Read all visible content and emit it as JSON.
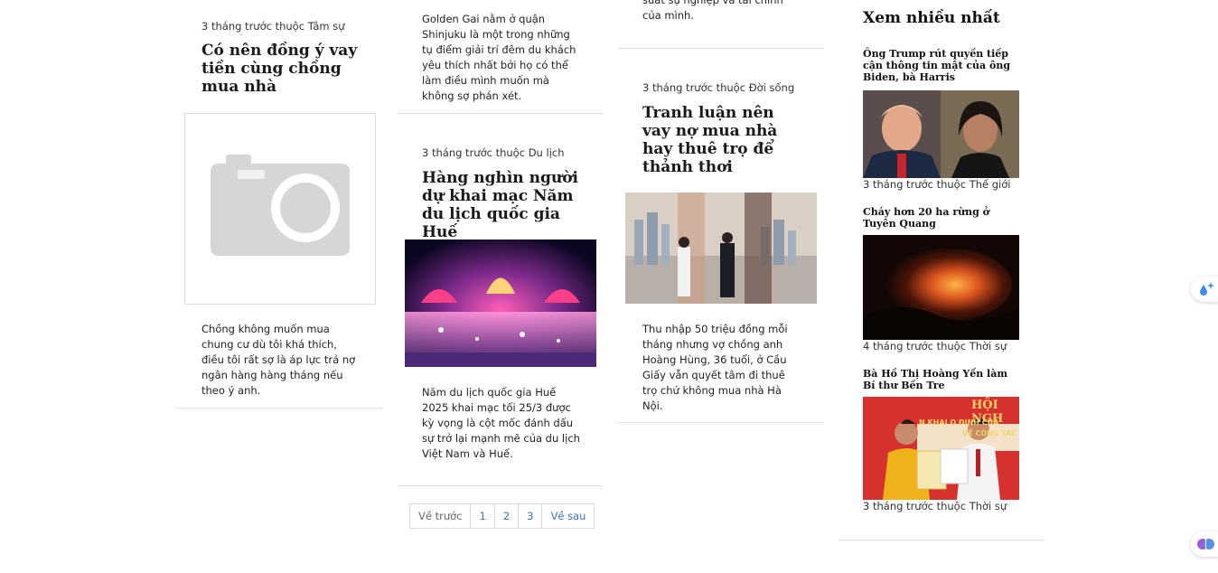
{
  "col1": {
    "meta": "3 tháng trước thuộc Tâm sự",
    "title": "Có nên đồng ý vay tiền cùng chồng mua nhà",
    "excerpt": "Chồng không muốn mua chung cư dù tôi khá thích, điều tôi rất sợ là áp lực trả nợ ngân hàng hàng tháng nếu theo ý anh.",
    "thumb_icon": "camera-placeholder-icon"
  },
  "col2": {
    "top_excerpt": "Golden Gai nằm ở quận Shinjuku là một trong những tụ điểm giải trí đêm du khách yêu thích nhất bởi họ có thể làm điều mình muốn mà không sợ phán xét.",
    "meta": "3 tháng trước thuộc Du lịch",
    "title": "Hàng nghìn người dự khai mạc Năm du lịch quốc gia Huế",
    "excerpt": "Năm du lịch quốc gia Huế 2025 khai mạc tối 25/3 được kỳ vọng là cột mốc đánh dấu sự trở lại mạnh mẽ của du lịch Việt Nam và Huế."
  },
  "col3": {
    "top_excerpt": "suất sự nghiệp và tài chính của mình.",
    "meta": "3 tháng trước thuộc Đời sống",
    "title": "Tranh luận nên vay nợ mua nhà hay thuê trọ để thảnh thơi",
    "excerpt": "Thu nhập 50 triệu đồng mỗi tháng nhưng vợ chồng anh Hoàng Hùng, 36 tuổi, ở Cầu Giấy vẫn quyết tâm đi thuê trọ chứ không mua nhà Hà Nội."
  },
  "sidebar": {
    "heading": "Xem nhiều nhất",
    "items": [
      {
        "title": "Ông Trump rút quyền tiếp cận thông tin mật của ông Biden, bà Harris",
        "meta": "3 tháng trước thuộc Thế giới"
      },
      {
        "title": "Cháy hơn 20 ha rừng ở Tuyên Quang",
        "meta": "4 tháng trước thuộc Thời sự"
      },
      {
        "title": "Bà Hồ Thị Hoàng Yến làm Bí thư Bến Tre",
        "meta": "3 tháng trước thuộc Thời sự"
      }
    ],
    "banner_text": "HỘI NGH",
    "banner_sub": "N KHAI Q   ĐỊNH CỦA",
    "banner_sub2": "VỀ CÔNG TÁC C"
  },
  "pagination": {
    "prev": "Về trước",
    "pages": [
      "1",
      "2",
      "3"
    ],
    "next": "Về sau"
  },
  "floating": {
    "top_icon": "sparkle-droplet-icon",
    "bottom_icon": "brain-icon"
  }
}
